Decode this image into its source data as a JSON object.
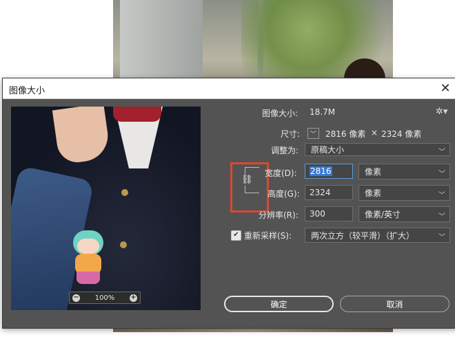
{
  "dialog": {
    "title": "图像大小",
    "close_icon": "close-icon"
  },
  "preview": {
    "zoom": "100%",
    "zoom_out_icon": "minus-circle-icon",
    "zoom_in_icon": "plus-circle-icon"
  },
  "info": {
    "image_size_label": "图像大小:",
    "image_size_value": "18.7M",
    "dimensions_label": "尺寸:",
    "dimensions_width": "2816 像素",
    "dimensions_times": "×",
    "dimensions_height": "2324 像素",
    "settings_icon": "gear-icon"
  },
  "fit_to": {
    "label": "调整为:",
    "value": "原稿大小"
  },
  "width": {
    "label": "宽度(D):",
    "value": "2816",
    "unit": "像素"
  },
  "height": {
    "label": "高度(G):",
    "value": "2324",
    "unit": "像素"
  },
  "resolution": {
    "label": "分辨率(R):",
    "value": "300",
    "unit": "像素/英寸"
  },
  "resample": {
    "label": "重新采样(S):",
    "checked": true,
    "value": "两次立方（较平滑）（扩大）"
  },
  "buttons": {
    "ok": "确定",
    "cancel": "取消"
  },
  "colors": {
    "dialog_bg": "#535353",
    "highlight": "#d94a2f",
    "selection": "#3a77d0"
  }
}
